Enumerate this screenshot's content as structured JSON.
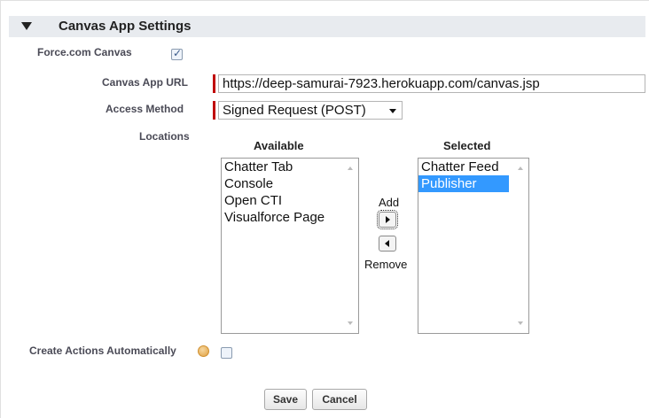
{
  "section": {
    "title": "Canvas App Settings",
    "icon": "collapse-triangle-icon"
  },
  "fields": {
    "force_canvas": {
      "label": "Force.com Canvas",
      "checked": true
    },
    "canvas_url": {
      "label": "Canvas App URL",
      "value": "https://deep-samurai-7923.herokuapp.com/canvas.jsp"
    },
    "access_method": {
      "label": "Access Method",
      "value": "Signed Request (POST)"
    },
    "locations": {
      "label": "Locations"
    },
    "create_actions": {
      "label": "Create Actions Automatically",
      "checked": false,
      "help_icon": "help-icon"
    }
  },
  "locations": {
    "available_header": "Available",
    "selected_header": "Selected",
    "available": [
      "Chatter Tab",
      "Console",
      "Open CTI",
      "Visualforce Page"
    ],
    "selected": [
      "Chatter Feed",
      "Publisher"
    ],
    "selected_highlight": "Publisher",
    "add_label": "Add",
    "remove_label": "Remove"
  },
  "buttons": {
    "save": "Save",
    "cancel": "Cancel"
  },
  "colors": {
    "header_bg": "#e8ebef",
    "required": "#c00000",
    "selection": "#3399ff"
  }
}
